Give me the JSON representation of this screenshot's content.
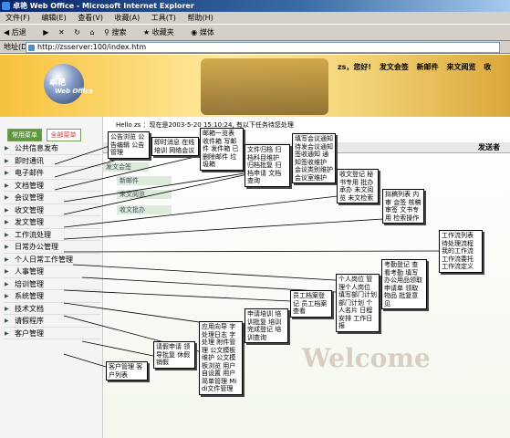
{
  "window_title": "卓艳 Web Office - Microsoft Internet Explorer",
  "menubar": [
    "文件(F)",
    "编辑(E)",
    "查看(V)",
    "收藏(A)",
    "工具(T)",
    "帮助(H)"
  ],
  "toolbar": [
    "后退",
    "搜索",
    "收藏夹",
    "媒体"
  ],
  "address": {
    "label": "地址(D)",
    "url": "http://zsserver:100/index.htm"
  },
  "logo": {
    "zh": "卓艳",
    "en": "Web Office"
  },
  "greeting": [
    "zs，您好!",
    "发文会签",
    "新邮件",
    "来文阅览",
    "收"
  ],
  "tabs": {
    "active": "常用菜单",
    "inactive": "全部菜单"
  },
  "menu": [
    "公共信息发布",
    "即时通讯",
    "电子邮件",
    "文档管理",
    "会议管理",
    "收文管理",
    "发文管理",
    "工作流处理",
    "日常办公管理",
    "个人日常工作管理",
    "人事管理",
    "培训管理",
    "系统管理",
    "技术文档",
    "请假程序",
    "客户管理"
  ],
  "hello": "Hello zs ：现在是2003-5-20 15:10:24, 有以下任务待您处理",
  "sender_col": "发送者",
  "welcome": "Welcome",
  "strips": [
    "发文会签",
    "新邮件",
    "来文阅览",
    "收文批办"
  ],
  "callouts": {
    "public": "公告浏览 公告编辑 公告管理",
    "im": "即时消息 在线培训 网络会议",
    "mail": "邮箱一览表 收件箱 写邮件 发件箱 已删除邮件 垃圾箱",
    "doc": "文件归档 归档科目维护 归档批复 归档申请 文档查询",
    "meeting": "填写会议通知 待发会议通知 签收通知 通知签收维护 会议类别维护 会议室维护",
    "receive": "收文登记 秘书专用 批办 承办 未文阅览 未文检索",
    "send": "拟稿列表 内审 会签 核稿 审签 文书专用 检索操作",
    "workflow": "工作流列表 待处理流程 我的工作流 工作流委托 工作流定义",
    "daily": "考勤登记 查看考勤 填写办公用品领取申请单 领取物品 批复意见",
    "personal": "个人岗位 管理个人岗位 填写部门计划 部门计划 个人名片 日程安排 工作日报",
    "hr": "员工档案登记 员工档案查看",
    "training": "申请培训 培训批复 培训完成登记 培训查询",
    "system": "应用向导 字处理日志 字处理 附件管理 公文模板维护 公文模板浏览 用户自设置 用户简单管理 Midi文件管理",
    "leave": "请假申请 领导批复 休假 销假",
    "client": "客户管理 客户列表"
  }
}
